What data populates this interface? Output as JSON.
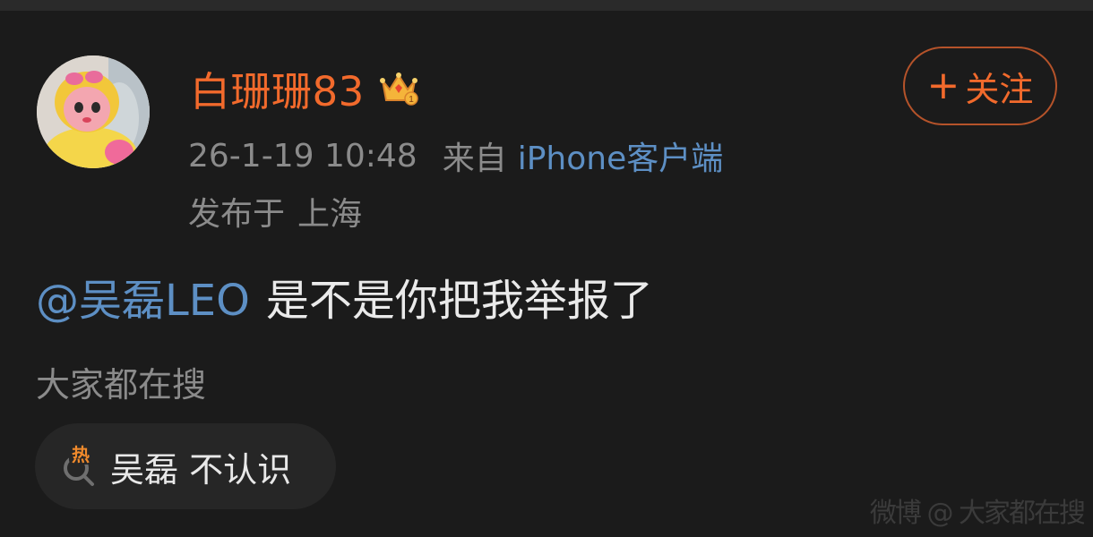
{
  "post": {
    "author": {
      "name": "白珊珊83",
      "avatar_icon": "avatar-doll-icon",
      "badge_icon": "crown-icon",
      "badge_level": "1"
    },
    "follow_button": {
      "plus": "+",
      "label": "关注"
    },
    "meta": {
      "timestamp": "26-1-19 10:48",
      "from_label": "来自",
      "client": "iPhone客户端"
    },
    "location": {
      "prefix": "发布于",
      "place": "上海"
    },
    "content": {
      "mention": "@吴磊LEO",
      "text": "是不是你把我举报了"
    }
  },
  "trending": {
    "heading": "大家都在搜",
    "chip": {
      "icon": "hot-search-icon",
      "hot_label": "热",
      "query": "吴磊 不认识"
    }
  },
  "watermark": {
    "text": "微博 @ 大家都在搜"
  },
  "colors": {
    "background": "#1b1b1b",
    "username": "#f26a2c",
    "link": "#5d8fc4",
    "muted": "#8b8b8b",
    "chip_bg": "#262626"
  }
}
